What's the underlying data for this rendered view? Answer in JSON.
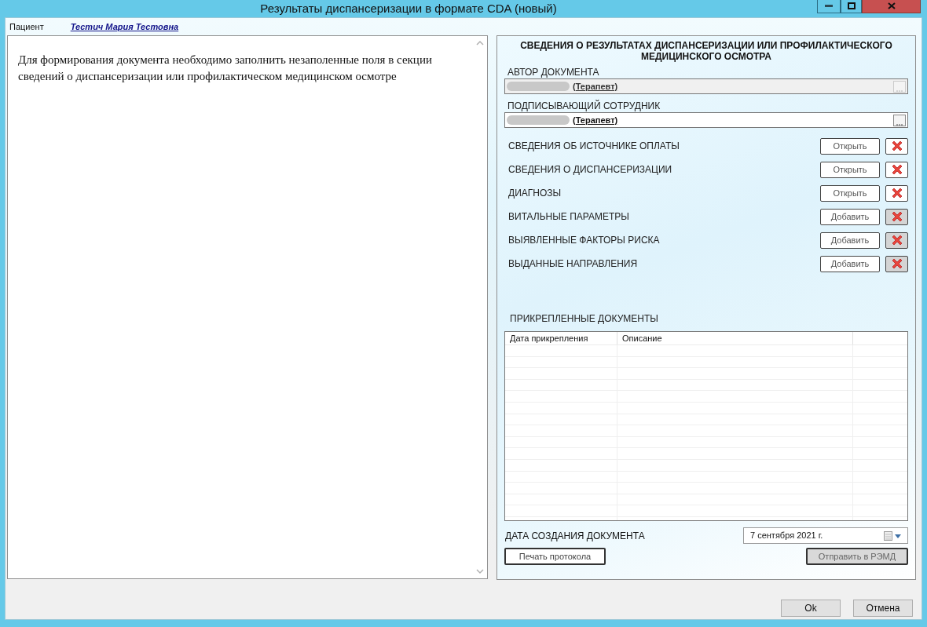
{
  "window": {
    "title": "Результаты диспансеризации в формате CDA (новый)"
  },
  "patient": {
    "label": "Пациент",
    "name": "Тестич Мария Тестовна"
  },
  "message": "Для формирования документа необходимо заполнить незаполенные поля в секции сведений о диспансеризации или профилактическом медицинском осмотре",
  "panel": {
    "title": "СВЕДЕНИЯ О РЕЗУЛЬТАТАХ ДИСПАНСЕРИЗАЦИИ ИЛИ ПРОФИЛАКТИЧЕСКОГО МЕДИЦИНСКОГО ОСМОТРА",
    "fields": [
      {
        "label": "АВТОР ДОКУМЕНТА",
        "value": "(Терапевт)",
        "disabled": true
      },
      {
        "label": "ПОДПИСЫВАЮЩИЙ СОТРУДНИК",
        "value": "(Терапевт)",
        "disabled": false
      }
    ],
    "sections": [
      {
        "label": "СВЕДЕНИЯ ОБ ИСТОЧНИКЕ ОПЛАТЫ",
        "button": "Открыть",
        "delete_disabled": false
      },
      {
        "label": "СВЕДЕНИЯ О ДИСПАНСЕРИЗАЦИИ",
        "button": "Открыть",
        "delete_disabled": false
      },
      {
        "label": "ДИАГНОЗЫ",
        "button": "Открыть",
        "delete_disabled": false
      },
      {
        "label": "ВИТАЛЬНЫЕ ПАРАМЕТРЫ",
        "button": "Добавить",
        "delete_disabled": true
      },
      {
        "label": "ВЫЯВЛЕННЫЕ ФАКТОРЫ РИСКА",
        "button": "Добавить",
        "delete_disabled": true
      },
      {
        "label": "ВЫДАННЫЕ НАПРАВЛЕНИЯ",
        "button": "Добавить",
        "delete_disabled": true
      }
    ],
    "attachments": {
      "title": "ПРИКРЕПЛЕННЫЕ ДОКУМЕНТЫ",
      "columns": [
        "Дата прикрепления",
        "Описание"
      ]
    },
    "date": {
      "label": "ДАТА СОЗДАНИЯ ДОКУМЕНТА",
      "value": "7 сентября 2021 г."
    },
    "print_button": {
      "label": "Печать протокола",
      "disabled": false
    },
    "send_button": {
      "label": "Отправить в РЭМД",
      "disabled": true
    }
  },
  "buttons": [
    "Ok",
    "Отмена"
  ]
}
